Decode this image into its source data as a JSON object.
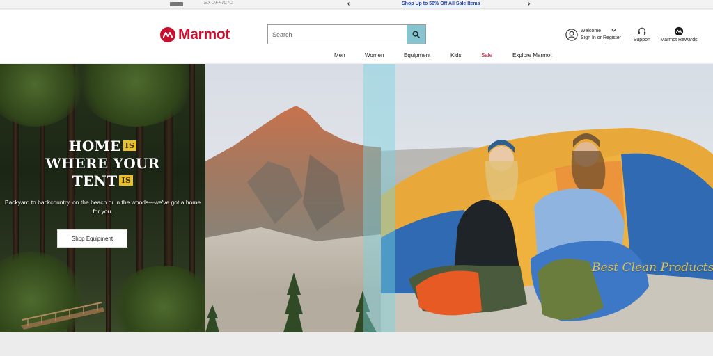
{
  "promo": {
    "message": "Shop Up to 50% Off All Sale Items",
    "prev_arrow": "‹",
    "next_arrow": "›",
    "partner_logo_2": "EXOFFICIO"
  },
  "header": {
    "brand": "Marmot",
    "search_placeholder": "Search",
    "welcome": "Welcome",
    "sign_in": "Sign In",
    "or": "or",
    "register": "Register",
    "support": "Support",
    "rewards": "Marmot Rewards",
    "brand_color": "#c8102e",
    "search_button_color": "#86c4cf"
  },
  "nav": {
    "items": [
      "Men",
      "Women",
      "Equipment",
      "Kids",
      "Sale",
      "Explore Marmot"
    ]
  },
  "hero": {
    "headline_1": "HOME",
    "tag_1": "IS",
    "headline_2": "WHERE YOUR",
    "headline_3": "TENT",
    "tag_2": "IS",
    "subcopy": "Backyard to backcountry, on the beach or in the woods—we've got a home for you.",
    "cta": "Shop Equipment",
    "tag_color": "#e8c227"
  },
  "watermark": "Best Clean Products",
  "icons": {
    "search": "search-icon",
    "account": "user-icon",
    "support": "headset-icon",
    "rewards": "marmot-rewards-icon",
    "chevron": "chevron-down-icon"
  }
}
